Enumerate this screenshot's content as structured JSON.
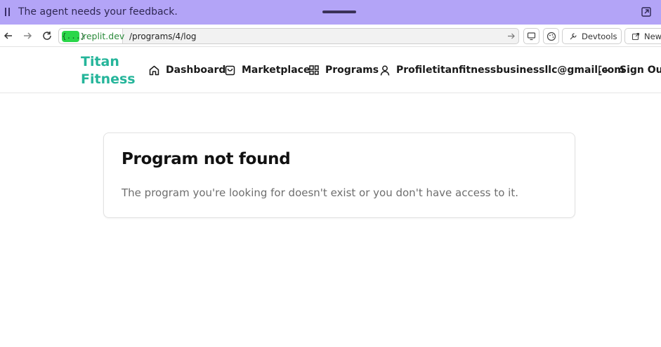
{
  "agent_banner": {
    "message": "The agent needs your feedback."
  },
  "browser": {
    "url_badge": "{...}",
    "url_host": ".replit.dev",
    "url_path": "/programs/4/log",
    "devtools_label": "Devtools",
    "new_tab_label": "New"
  },
  "app": {
    "brand_line1": "Titan",
    "brand_line2": "Fitness",
    "nav": {
      "dashboard": "Dashboard",
      "marketplace": "Marketplace",
      "programs": "Programs",
      "profile": "Profiletitanfitnessbusinessllc@gmail.com",
      "sign_out": "Sign Out"
    }
  },
  "card": {
    "title": "Program not found",
    "description": "The program you're looking for doesn't exist or you don't have access to it."
  },
  "colors": {
    "agent_banner": "#b3a4f7",
    "brand": "#25b59a",
    "url_badge": "#2bd74a"
  }
}
